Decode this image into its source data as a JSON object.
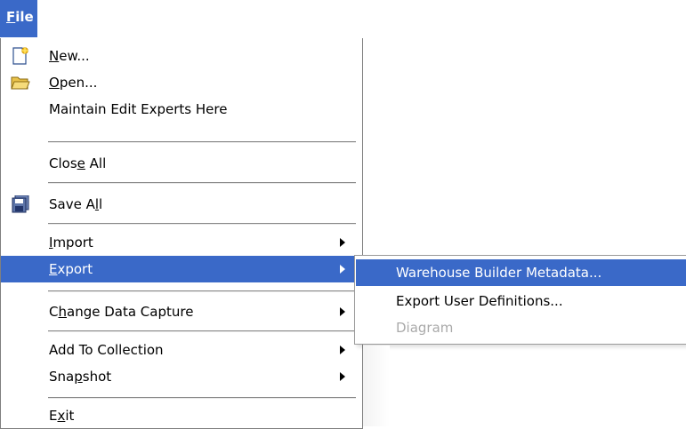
{
  "menubar": {
    "file_label": "File",
    "file_mnemonic": "F",
    "file_rest": "ile"
  },
  "menu": {
    "items": [
      {
        "pre": "",
        "mn": "N",
        "post": "ew...",
        "icon": "new-file-icon"
      },
      {
        "pre": "",
        "mn": "O",
        "post": "pen...",
        "icon": "open-folder-icon"
      },
      {
        "pre": "Maintain Edit Experts Here",
        "mn": "",
        "post": ""
      },
      {
        "pre": "Clos",
        "mn": "e",
        "post": " All"
      },
      {
        "pre": "Save A",
        "mn": "l",
        "post": "l",
        "icon": "save-all-icon"
      },
      {
        "pre": "",
        "mn": "I",
        "post": "mport"
      },
      {
        "pre": "",
        "mn": "E",
        "post": "xport"
      },
      {
        "pre": "C",
        "mn": "h",
        "post": "ange Data Capture"
      },
      {
        "pre": "Add To Collection",
        "mn": "",
        "post": ""
      },
      {
        "pre": "Sna",
        "mn": "p",
        "post": "shot"
      },
      {
        "pre": "E",
        "mn": "x",
        "post": "it"
      }
    ]
  },
  "submenu": {
    "items": [
      {
        "label": "Warehouse Builder Metadata..."
      },
      {
        "label": "Export User Definitions..."
      },
      {
        "label": "Diagram"
      }
    ]
  },
  "colors": {
    "selection": "#3a69c8",
    "disabled": "#aaaaaa",
    "separator": "#8a8a8a"
  }
}
